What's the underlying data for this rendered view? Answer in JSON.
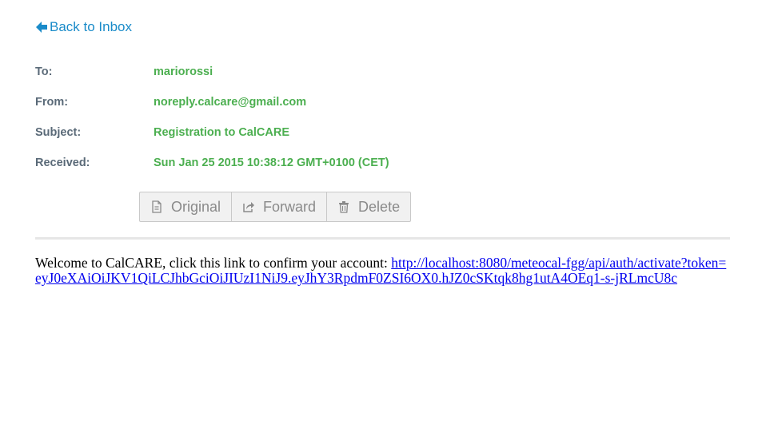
{
  "nav": {
    "back_label": "Back to Inbox",
    "back_icon": "arrow-left-icon"
  },
  "message": {
    "fields": [
      {
        "label": "To:",
        "value": "mariorossi"
      },
      {
        "label": "From:",
        "value": "noreply.calcare@gmail.com"
      },
      {
        "label": "Subject:",
        "value": "Registration to CalCARE"
      },
      {
        "label": "Received:",
        "value": "Sun Jan 25 2015 10:38:12 GMT+0100 (CET)"
      }
    ]
  },
  "actions": {
    "original_label": "Original",
    "original_icon": "document-icon",
    "forward_label": "Forward",
    "forward_icon": "share-icon",
    "delete_label": "Delete",
    "delete_icon": "trash-icon"
  },
  "body": {
    "text": "Welcome to CalCARE, click this link to confirm your account: ",
    "link": "http://localhost:8080/meteocal-fgg/api/auth/activate?token=eyJ0eXAiOiJKV1QiLCJhbGciOiJIUzI1NiJ9.eyJhY3RpdmF0ZSI6OX0.hJZ0cSKtqk8hg1utA4OEq1-s-jRLmcU8c"
  },
  "colors": {
    "link": "#1a8bc9",
    "field_value": "#4caf50",
    "field_label": "#5a6a78",
    "button_text": "#8a8a8a",
    "body_link": "#0000ee"
  }
}
